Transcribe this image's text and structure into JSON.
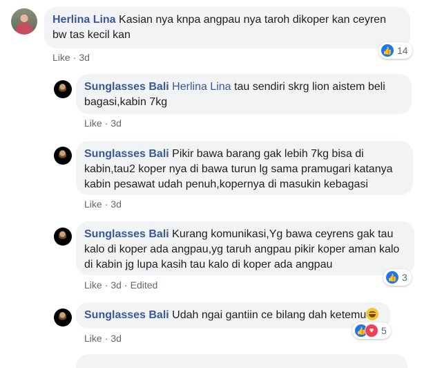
{
  "comments": [
    {
      "author": "Herlina Lina",
      "text": "Kasian nya knpa angpau nya taroh dikoper kan ceyren bw tas kecil kan",
      "like_label": "Like",
      "time": "3d",
      "reaction_count": "14"
    }
  ],
  "replies": [
    {
      "author": "Sunglasses Bali",
      "mention": "Herlina Lina",
      "text": "tau sendiri skrg lion aistem beli bagasi,kabin 7kg",
      "like_label": "Like",
      "time": "3d"
    },
    {
      "author": "Sunglasses Bali",
      "text": "Pikir bawa barang gak lebih 7kg bisa di kabin,tau2 koper nya di bawa turun lg sama pramugari katanya kabin pesawat udah penuh,kopernya di masukin kebagasi",
      "like_label": "Like",
      "time": "3d"
    },
    {
      "author": "Sunglasses Bali",
      "text": "Kurang komunikasi,Yg bawa ceyrens gak tau kalo di koper ada angpau,yg taruh angpau pikir koper aman kalo di kabin jg lupa kasih tau kalo di koper ada angpau",
      "like_label": "Like",
      "time": "3d",
      "edited_label": "Edited",
      "reaction_count": "3"
    },
    {
      "author": "Sunglasses Bali",
      "text": "Udah ngai gantiin ce bilang dah ketemu",
      "emoji": "grinning-face-with-sweat",
      "like_label": "Like",
      "time": "3d",
      "reaction_count": "5"
    }
  ],
  "colors": {
    "author": "#385898",
    "bubble": "#f2f3f5",
    "meta": "#606770",
    "like_reaction": "#1877f2",
    "love_reaction": "#f33e58"
  }
}
